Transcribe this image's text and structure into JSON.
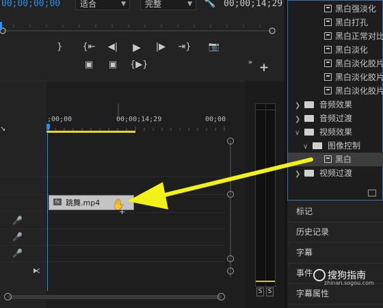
{
  "monitor": {
    "timecode_left": "00;00;00;00",
    "fit_label": "适合",
    "quality_label": "完整",
    "timecode_right": "00;00;14;29"
  },
  "timeline": {
    "ruler_labels": [
      ";00;00",
      "00;00;14;29",
      "00;00"
    ],
    "clip_name": "跳舞.mp4"
  },
  "effects": {
    "items": [
      {
        "kind": "fx",
        "label": "黑白强淡化"
      },
      {
        "kind": "fx",
        "label": "黑白打孔"
      },
      {
        "kind": "fx",
        "label": "黑白正常对比"
      },
      {
        "kind": "fx",
        "label": "黑白淡化"
      },
      {
        "kind": "fx",
        "label": "黑白淡化胶片"
      },
      {
        "kind": "fx",
        "label": "黑白淡化胶片"
      },
      {
        "kind": "fx",
        "label": "黑白淡化胶片"
      },
      {
        "kind": "folder",
        "label": "音频效果"
      },
      {
        "kind": "folder",
        "label": "音频过渡"
      },
      {
        "kind": "folder",
        "label": "视频效果"
      },
      {
        "kind": "subfolder",
        "label": "图像控制"
      },
      {
        "kind": "selected",
        "label": "黑白"
      },
      {
        "kind": "folder",
        "label": "视频过渡"
      }
    ]
  },
  "panels": {
    "tabs": [
      "标记",
      "历史记录",
      "字幕",
      "事件",
      "字幕属性"
    ]
  },
  "meter": {
    "solo_left": "S",
    "solo_right": "S"
  },
  "watermark": {
    "brand": "搜狗指南",
    "url": "zhinan.sogou.com"
  },
  "colors": {
    "accent_blue": "#2e8ee8",
    "arrow_yellow": "#f2f21a",
    "selection_bg": "#3d3d3d"
  }
}
